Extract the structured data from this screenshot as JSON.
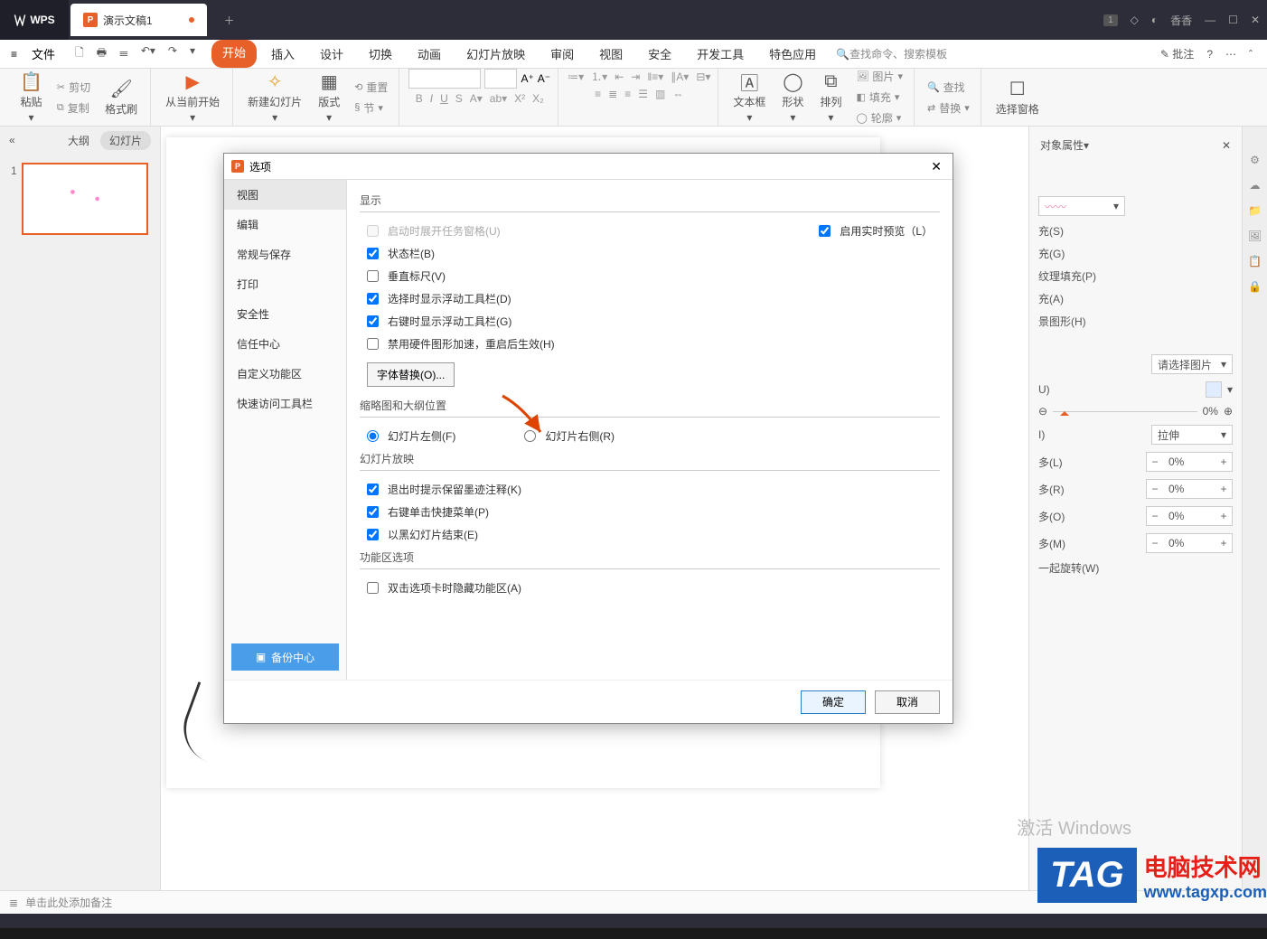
{
  "titlebar": {
    "wps_label": "WPS",
    "doc_name": "演示文稿1",
    "badge": "1",
    "user": "香香"
  },
  "menu": {
    "file": "文件",
    "tabs": [
      "开始",
      "插入",
      "设计",
      "切换",
      "动画",
      "幻灯片放映",
      "审阅",
      "视图",
      "安全",
      "开发工具",
      "特色应用"
    ],
    "search_placeholder": "查找命令、搜索模板",
    "annotate": "批注"
  },
  "ribbon": {
    "paste": "粘贴",
    "cut": "剪切",
    "copy": "复制",
    "format_painter": "格式刷",
    "from_current": "从当前开始",
    "new_slide": "新建幻灯片",
    "layout": "版式",
    "reset": "重置",
    "section": "节",
    "textbox": "文本框",
    "shape": "形状",
    "arrange": "排列",
    "picture": "图片",
    "fill": "填充",
    "outline": "轮廓",
    "find": "查找",
    "replace": "替换",
    "select_pane": "选择窗格"
  },
  "left": {
    "collapse": "«",
    "outline": "大纲",
    "slides": "幻灯片",
    "thumb_num": "1"
  },
  "right_panel": {
    "title": "对象属性",
    "fill_s": "充(S)",
    "fill_g": "充(G)",
    "tex_fill": "纹理填充(P)",
    "fill_a": "充(A)",
    "bg_shape": "景图形(H)",
    "select_pic": "请选择图片",
    "u": "U)",
    "pct": "0%",
    "i": "I)",
    "stretch": "拉伸",
    "offsets": {
      "l": "多(L)",
      "r": "多(R)",
      "o": "多(O)",
      "m": "多(M)"
    },
    "offset_val": "0%",
    "rotate": "一起旋转(W)"
  },
  "dialog": {
    "title": "选项",
    "nav": [
      "视图",
      "编辑",
      "常规与保存",
      "打印",
      "安全性",
      "信任中心",
      "自定义功能区",
      "快速访问工具栏"
    ],
    "backup": "备份中心",
    "sec_display": "显示",
    "opt_startup": "启动时展开任务窗格(U)",
    "opt_live_preview": "启用实时预览（L）",
    "opt_statusbar": "状态栏(B)",
    "opt_vruler": "垂直标尺(V)",
    "opt_float_toolbar": "选择时显示浮动工具栏(D)",
    "opt_rclick_toolbar": "右键时显示浮动工具栏(G)",
    "opt_disable_hw": "禁用硬件图形加速，重启后生效(H)",
    "font_sub": "字体替换(O)...",
    "sec_thumb": "缩略图和大纲位置",
    "radio_left": "幻灯片左侧(F)",
    "radio_right": "幻灯片右侧(R)",
    "sec_slideshow": "幻灯片放映",
    "opt_ink": "退出时提示保留墨迹注释(K)",
    "opt_rclick_menu": "右键单击快捷菜单(P)",
    "opt_end_black": "以黑幻灯片结束(E)",
    "sec_ribbon": "功能区选项",
    "opt_dbl_hide": "双击选项卡时隐藏功能区(A)",
    "ok": "确定",
    "cancel": "取消"
  },
  "notes": {
    "placeholder": "单击此处添加备注"
  },
  "watermark": {
    "activate": "激活 Windows",
    "tag": "TAG",
    "site_cn": "电脑技术网",
    "site_url": "www.tagxp.com"
  }
}
